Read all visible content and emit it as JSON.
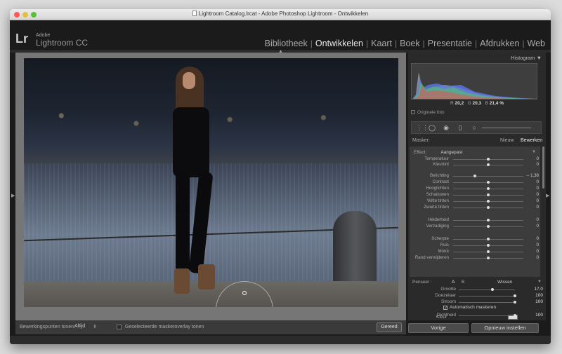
{
  "window": {
    "title": "Lightroom Catalog.lrcat - Adobe Photoshop Lightroom - Ontwikkelen"
  },
  "identity": {
    "logo": "Lr",
    "brand_small": "Adobe",
    "brand_large": "Lightroom CC"
  },
  "modules": [
    {
      "label": "Bibliotheek",
      "active": false
    },
    {
      "label": "Ontwikkelen",
      "active": true
    },
    {
      "label": "Kaart",
      "active": false
    },
    {
      "label": "Boek",
      "active": false
    },
    {
      "label": "Presentatie",
      "active": false
    },
    {
      "label": "Afdrukken",
      "active": false
    },
    {
      "label": "Web",
      "active": false
    }
  ],
  "histogram": {
    "title": "Histogram",
    "r_label": "R",
    "r_value": "20,2",
    "g_label": "G",
    "g_value": "20,3",
    "b_label": "B",
    "b_value": "21,4",
    "pct": "%",
    "original_photo": "Originele foto"
  },
  "mask": {
    "label": "Masker:",
    "new": "Nieuw",
    "edit": "Bewerken"
  },
  "effect": {
    "label": "Effect:",
    "value": "Aangepast"
  },
  "sliders": [
    {
      "label": "Temperatuur",
      "value": "0",
      "pos": 0.5
    },
    {
      "label": "Kleurtint",
      "value": "0",
      "pos": 0.5
    },
    {
      "label": "Belichting",
      "value": "– 1,38",
      "pos": 0.31
    },
    {
      "label": "Contrast",
      "value": "0",
      "pos": 0.5
    },
    {
      "label": "Hooglichten",
      "value": "0",
      "pos": 0.5
    },
    {
      "label": "Schaduwen",
      "value": "0",
      "pos": 0.5
    },
    {
      "label": "Witte tinten",
      "value": "0",
      "pos": 0.5
    },
    {
      "label": "Zwarte tinten",
      "value": "0",
      "pos": 0.5
    },
    {
      "label": "Helderheid",
      "value": "0",
      "pos": 0.5
    },
    {
      "label": "Verzadiging",
      "value": "0",
      "pos": 0.5
    },
    {
      "label": "Scherpte",
      "value": "0",
      "pos": 0.5
    },
    {
      "label": "Ruis",
      "value": "0",
      "pos": 0.5
    },
    {
      "label": "Moiré",
      "value": "0",
      "pos": 0.5
    },
    {
      "label": "Rand verwijderen",
      "value": "0",
      "pos": 0.5
    }
  ],
  "color": {
    "label": "Kleur"
  },
  "brush": {
    "label": "Penseel :",
    "a": "A",
    "b": "B",
    "erase": "Wissen",
    "size_label": "Grootte",
    "size_value": "17,0",
    "size_pos": 0.6,
    "feather_label": "Doezelaar",
    "feather_value": "100",
    "feather_pos": 1.0,
    "flow_label": "Stroom",
    "flow_value": "100",
    "flow_pos": 1.0,
    "automask_label": "Automatisch maskeren",
    "automask_checked": true,
    "density_label": "Dichtheid",
    "density_value": "100",
    "density_pos": 1.0
  },
  "toolbar": {
    "show_pins_label": "Bewerkingspunten tonen:",
    "show_pins_value": "Altijd",
    "overlay_label": "Geselecteerde maskeroverlay tonen",
    "done": "Gereed"
  },
  "footer": {
    "previous": "Vorige",
    "reset": "Opnieuw instellen"
  }
}
